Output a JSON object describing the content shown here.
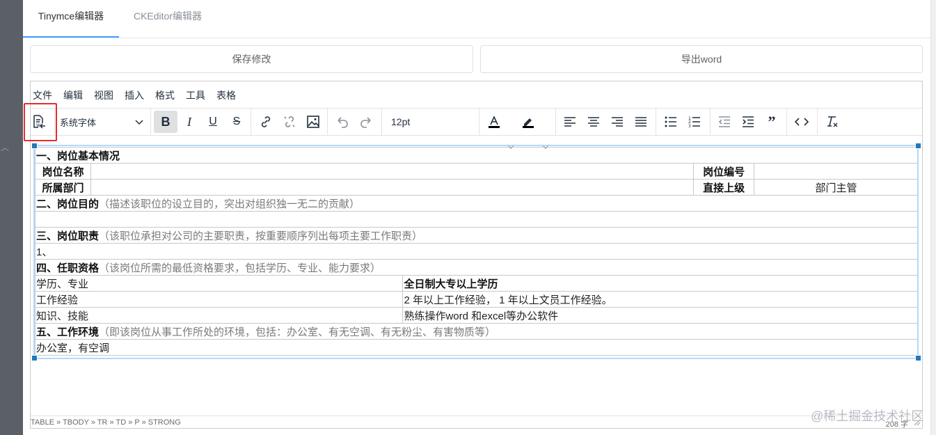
{
  "tabs": [
    {
      "label": "Tinymce编辑器",
      "active": true
    },
    {
      "label": "CKEditor编辑器",
      "active": false
    }
  ],
  "buttons": {
    "save": "保存修改",
    "export": "导出word"
  },
  "menubar": [
    "文件",
    "编辑",
    "视图",
    "插入",
    "格式",
    "工具",
    "表格"
  ],
  "toolbar": {
    "font_family": "系统字体",
    "font_size": "12pt",
    "icons": [
      "import-word-icon",
      "bold-icon",
      "italic-icon",
      "underline-icon",
      "strikethrough-icon",
      "link-icon",
      "unlink-icon",
      "image-icon",
      "undo-icon",
      "redo-icon",
      "text-color-icon",
      "highlight-color-icon",
      "align-left-icon",
      "align-center-icon",
      "align-right-icon",
      "align-justify-icon",
      "bullet-list-icon",
      "numbered-list-icon",
      "outdent-icon",
      "indent-icon",
      "blockquote-icon",
      "source-code-icon",
      "clear-format-icon"
    ],
    "active": [
      "bold-icon"
    ]
  },
  "doc": {
    "s1_title": "一、岗位基本情况",
    "job_name_label": "岗位名称",
    "job_no_label": "岗位编号",
    "dept_label": "所属部门",
    "superior_label": "直接上级",
    "superior_value": "部门主管",
    "s2_title": "二、岗位目的",
    "s2_hint": "（描述该职位的设立目的，突出对组织独一无二的贡献）",
    "s3_title": "三、岗位职责",
    "s3_hint": "（该职位承担对公司的主要职责，按重要顺序列出每项主要工作职责）",
    "s3_item": "1、",
    "s4_title": "四、任职资格",
    "s4_hint": "（该岗位所需的最低资格要求，包括学历、专业、能力要求）",
    "edu_label": "学历、专业",
    "edu_value": "全日制大专以上学历",
    "exp_label": "工作经验",
    "exp_value": " 2 年以上工作经验， 1 年以上文员工作经验。",
    "skill_label": "知识、技能",
    "skill_value": "熟练操作word 和excel等办公软件",
    "s5_title": "五、工作环境",
    "s5_hint": "（即该岗位从事工作所处的环境，包括：办公室、有无空调、有无粉尘、有害物质等）",
    "s5_value": "办公室，有空调"
  },
  "statusbar": {
    "path": "TABLE » TBODY » TR » TD » P » STRONG",
    "count": "208 字"
  },
  "watermark": "@稀土掘金技术社区",
  "colors": {
    "accent": "#409eff",
    "highlight_box": "#e62e2e",
    "selection": "#b4d7ff",
    "handle": "#207ab7"
  }
}
